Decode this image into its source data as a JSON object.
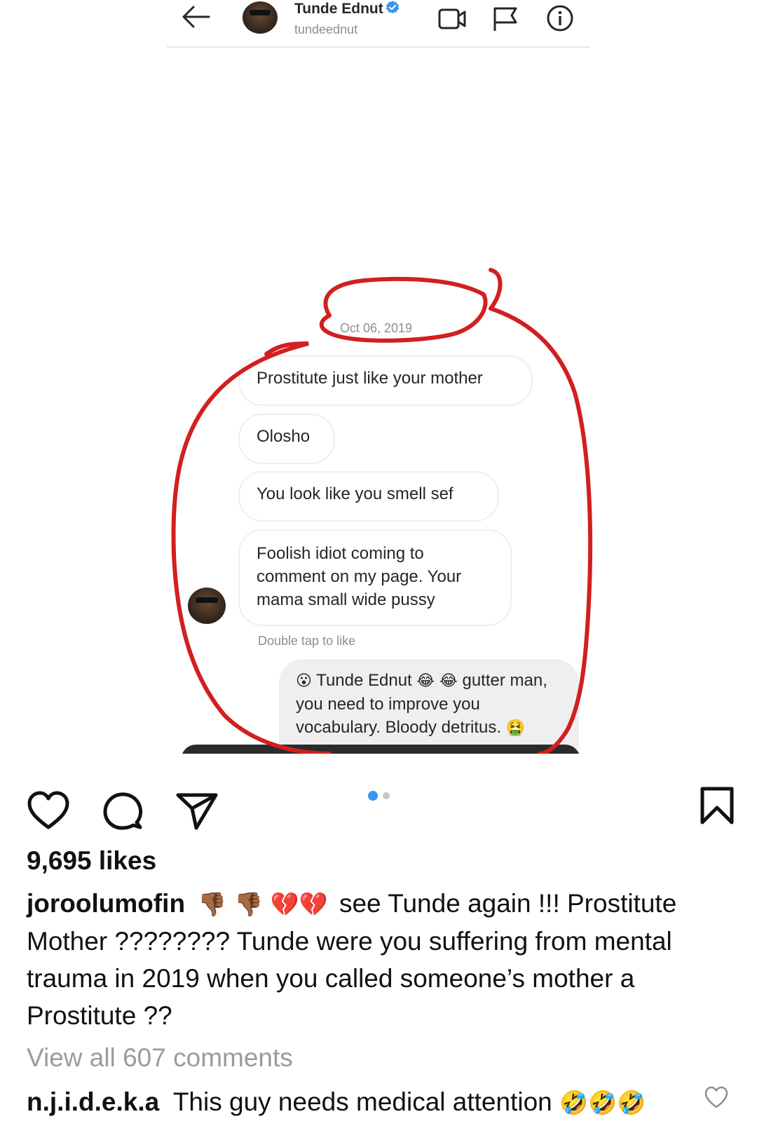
{
  "dm": {
    "name": "Tunde Ednut",
    "handle": "tundeednut",
    "date": "Oct 06, 2019",
    "messages": [
      "Prostitute just like your mother",
      "Olosho",
      "You look like you smell sef",
      "Foolish idiot coming to comment on my page. Your mama small wide pussy"
    ],
    "hint": "Double tap to like",
    "reply": {
      "prefix_emoji": "😮",
      "mention": "Tunde Ednut",
      "mid_emoji": "😂 😂",
      "text": "gutter man, you need to improve you vocabulary. Bloody detritus.",
      "end_emoji": "🤮"
    }
  },
  "post": {
    "likes": "9,695 likes",
    "caption": {
      "user": "joroolumofin",
      "emojis": "👎🏾 👎🏾 💔💔",
      "text": "see Tunde again !!! Prostitute Mother ???????? Tunde were you suffering from mental trauma in 2019 when you called someone’s mother a Prostitute ??"
    },
    "view_all": "View all 607 comments",
    "top_comment": {
      "user": "n.j.i.d.e.k.a",
      "text": "This guy needs medical attention",
      "emojis": "🤣🤣🤣"
    }
  },
  "colors": {
    "markup_red": "#d21f1f",
    "carousel_active": "#3897f0",
    "carousel_inactive": "#c7c7c7",
    "muted_text": "#8e8e8e"
  },
  "icons": [
    "arrow-left-icon",
    "verified-badge-icon",
    "video-call-icon",
    "flag-icon",
    "info-icon",
    "heart-icon",
    "comment-icon",
    "send-icon",
    "bookmark-icon"
  ]
}
